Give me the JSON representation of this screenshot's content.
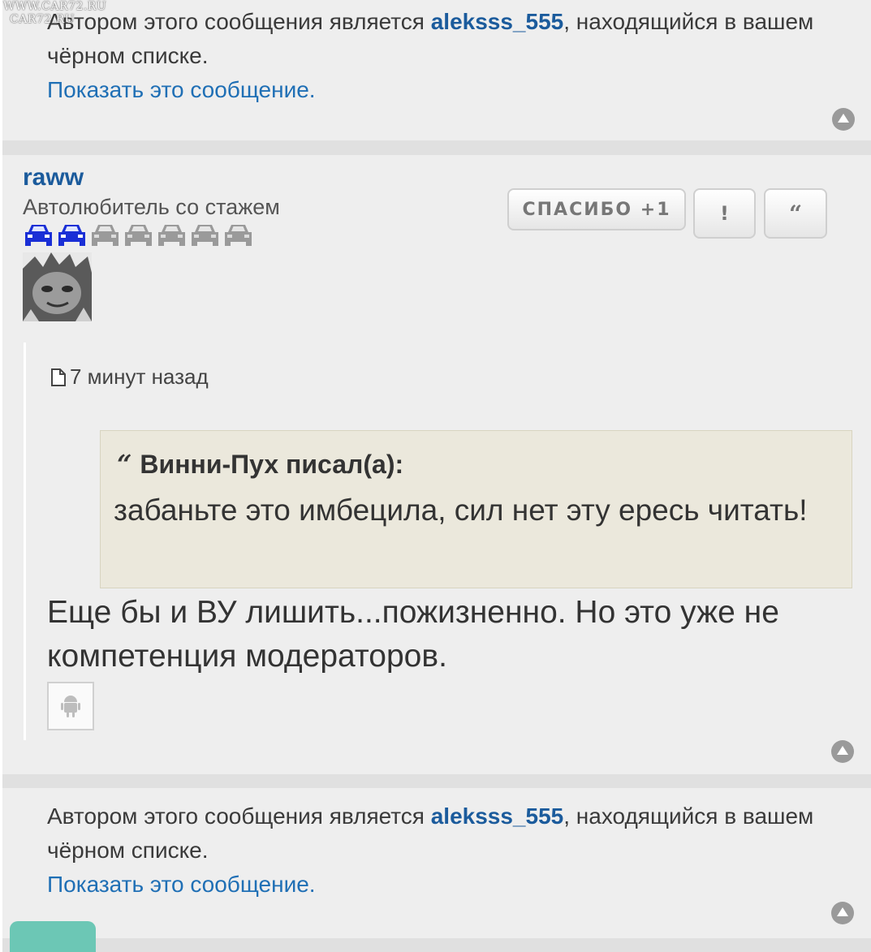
{
  "watermark": {
    "line1": "WWW.CAR72.RU",
    "line2": "CAR72.RU"
  },
  "blocked_post_top": {
    "prefix": "Автором этого сообщения является ",
    "username": "aleksss_555",
    "suffix": ", находящийся в вашем чёрном списке.",
    "show_link": "Показать это сообщение."
  },
  "post": {
    "username": "raww",
    "rank": "Автолюбитель со стажем",
    "rank_level": 2,
    "rank_max": 7,
    "buttons": {
      "thanks": "СПАСИБО +1",
      "report": "!",
      "quote": "“"
    },
    "time": "7 минут назад",
    "quote": {
      "mark": "“",
      "author": "Винни-Пух писал(а):",
      "text": "забаньте это имбецила, сил нет эту ересь читать!"
    },
    "text": "Еще бы и ВУ лишить...пожизненно. Но это уже не компетенция модераторов.",
    "device_icon": "android-icon"
  },
  "blocked_post_bottom": {
    "prefix": "Автором этого сообщения является ",
    "username": "aleksss_555",
    "suffix": ", находящийся в вашем чёрном списке.",
    "show_link": "Показать это сообщение."
  },
  "colors": {
    "link": "#1f6fb5",
    "username": "#1b5b9c",
    "car_active": "#1a2fd6",
    "car_inactive": "#9a9a9a",
    "quote_bg": "#ebe8dc",
    "teal_tab": "#6cc7b5"
  }
}
